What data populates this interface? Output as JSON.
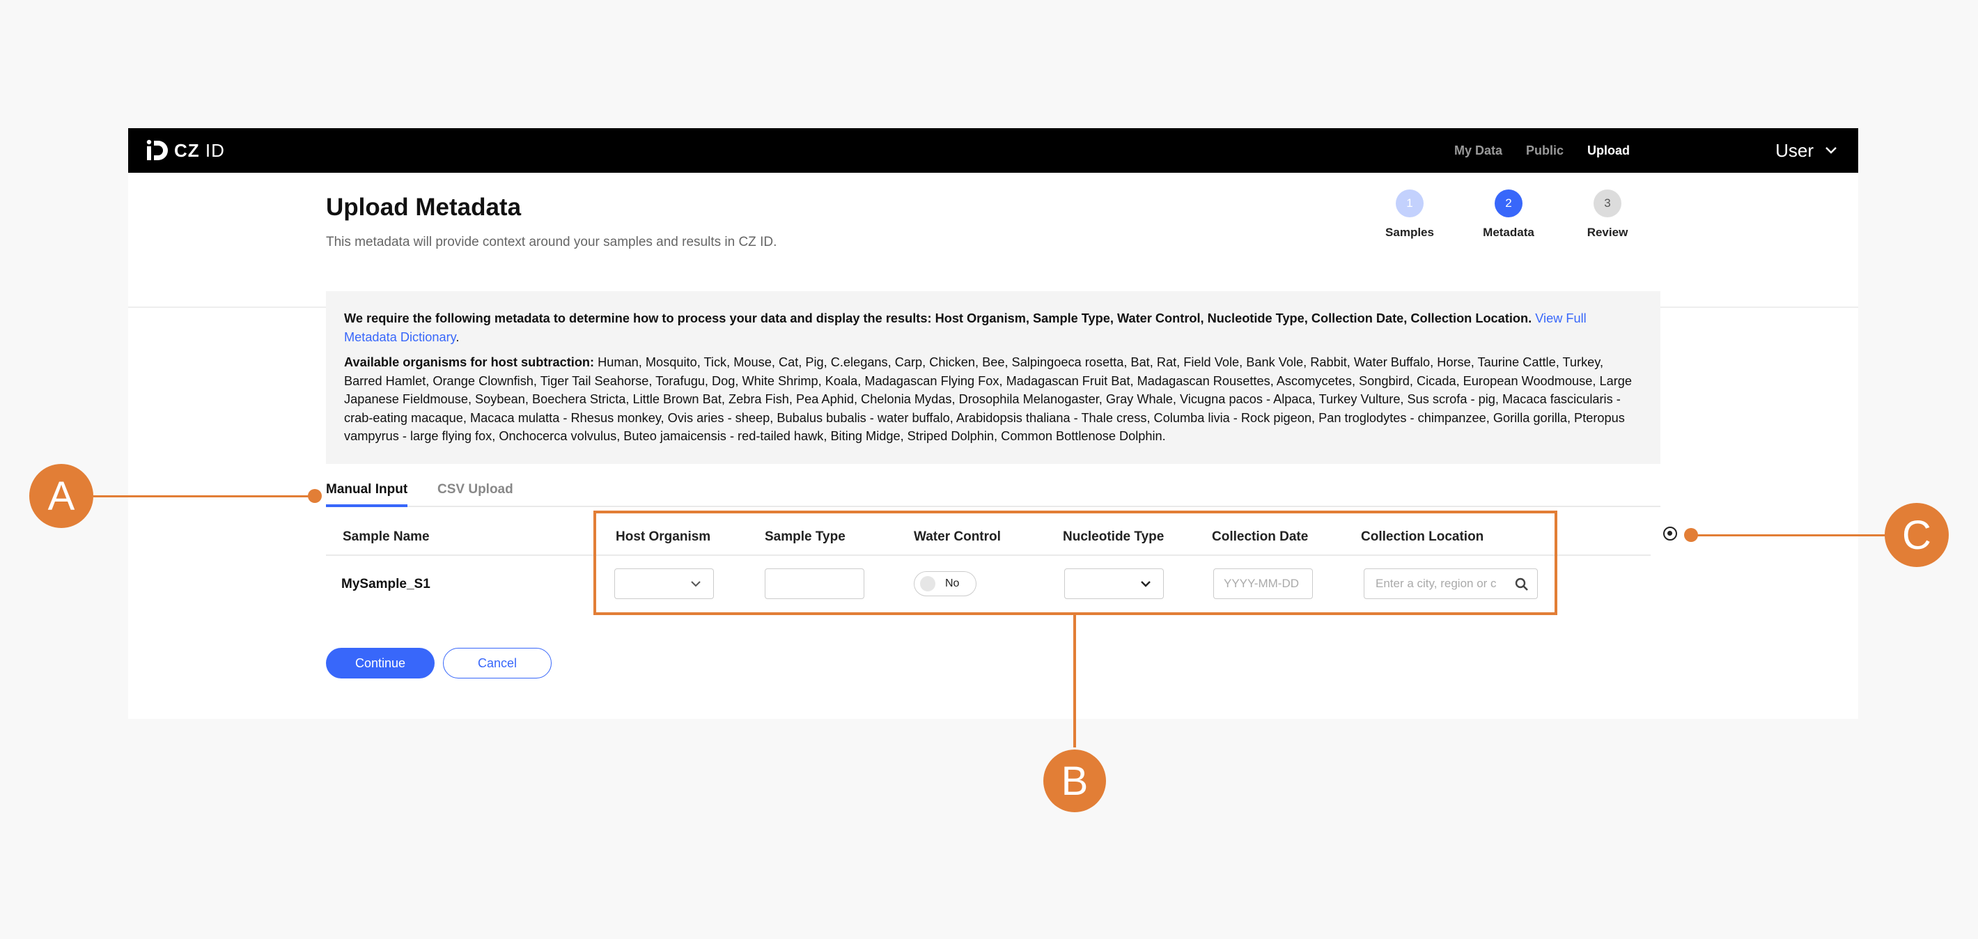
{
  "app": {
    "logo_mark": "ID",
    "logo_text": "CZ",
    "logo_text_suffix": "ID",
    "nav": [
      {
        "label": "My Data",
        "active": false
      },
      {
        "label": "Public",
        "active": false
      },
      {
        "label": "Upload",
        "active": true
      }
    ],
    "user_label": "User"
  },
  "header": {
    "title": "Upload Metadata",
    "subtitle": "This metadata will provide context around your samples and results in CZ ID."
  },
  "steps": [
    {
      "number": "1",
      "label": "Samples",
      "color": "#c3d1fd"
    },
    {
      "number": "2",
      "label": "Metadata",
      "color": "#3867fa"
    },
    {
      "number": "3",
      "label": "Review",
      "color": "#dcdcdc"
    }
  ],
  "info": {
    "required_text": "We require the following metadata to determine how to process your data and display the results: Host Organism, Sample Type, Water Control, Nucleotide Type, Collection Date, Collection Location.",
    "dictionary_link": "View Full Metadata Dictionary",
    "dictionary_period": ".",
    "organisms_label": "Available organisms for host subtraction:",
    "organisms_list": "Human, Mosquito, Tick, Mouse, Cat, Pig, C.elegans, Carp, Chicken, Bee, Salpingoeca rosetta, Bat, Rat, Field Vole, Bank Vole, Rabbit, Water Buffalo, Horse, Taurine Cattle, Turkey, Barred Hamlet, Orange Clownfish, Tiger Tail Seahorse, Torafugu, Dog, White Shrimp, Koala, Madagascan Flying Fox, Madagascan Fruit Bat, Madagascan Rousettes, Ascomycetes, Songbird, Cicada, European Woodmouse, Large Japanese Fieldmouse, Soybean, Boechera Stricta, Little Brown Bat, Zebra Fish, Pea Aphid, Chelonia Mydas, Drosophila Melanogaster, Gray Whale, Vicugna pacos - Alpaca, Turkey Vulture, Sus scrofa - pig, Macaca fascicularis - crab-eating macaque, Macaca mulatta - Rhesus monkey, Ovis aries - sheep, Bubalus bubalis - water buffalo, Arabidopsis thaliana - Thale cress, Columba livia - Rock pigeon, Pan troglodytes - chimpanzee, Gorilla gorilla, Pteropus vampyrus - large flying fox, Onchocerca volvulus, Buteo jamaicensis - red-tailed hawk, Biting Midge, Striped Dolphin, Common Bottlenose Dolphin."
  },
  "tabs": [
    {
      "label": "Manual Input",
      "active": true
    },
    {
      "label": "CSV Upload",
      "active": false
    }
  ],
  "table": {
    "columns": {
      "sample_name": "Sample Name",
      "host_organism": "Host Organism",
      "sample_type": "Sample Type",
      "water_control": "Water Control",
      "nucleotide_type": "Nucleotide Type",
      "collection_date": "Collection Date",
      "collection_location": "Collection Location"
    },
    "rows": [
      {
        "sample_name": "MySample_S1",
        "water_control_value": "No",
        "collection_date_placeholder": "YYYY-MM-DD",
        "collection_location_placeholder": "Enter a city, region or c"
      }
    ]
  },
  "buttons": {
    "continue": "Continue",
    "cancel": "Cancel"
  },
  "annotations": {
    "a": "A",
    "b": "B",
    "c": "C",
    "color": "#e27e36"
  },
  "colors": {
    "accent": "#3867fa",
    "topbar": "#000000"
  }
}
